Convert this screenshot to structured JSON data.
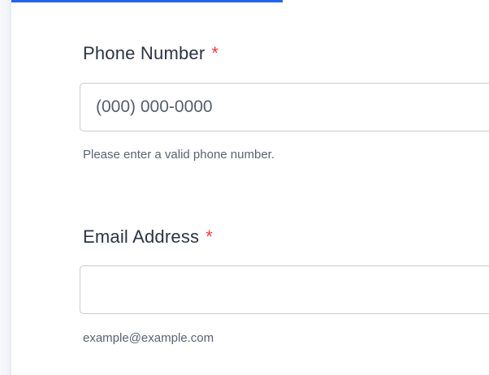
{
  "phone_field": {
    "label": "Phone Number",
    "required_mark": "*",
    "placeholder": "(000) 000-0000",
    "hint": "Please enter a valid phone number."
  },
  "email_field": {
    "label": "Email Address",
    "required_mark": "*",
    "value": "",
    "hint": "example@example.com"
  },
  "colors": {
    "required": "#f23a3c",
    "link_underline": "#2563eb",
    "label_text": "#2c3345",
    "input_border": "#c8cbd3"
  }
}
